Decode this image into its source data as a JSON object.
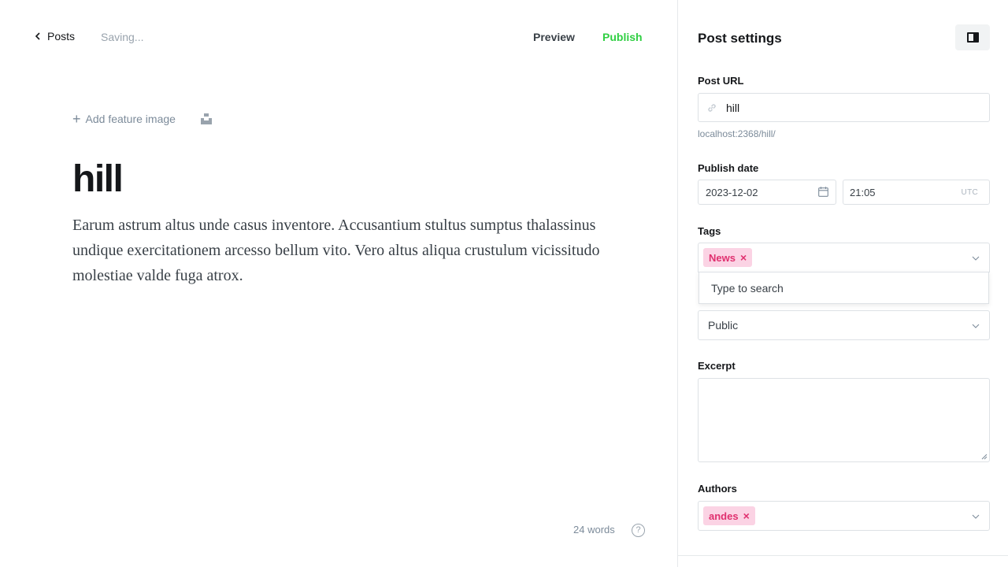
{
  "topbar": {
    "back_label": "Posts",
    "status": "Saving...",
    "preview_label": "Preview",
    "publish_label": "Publish"
  },
  "editor": {
    "add_feature_image": "Add feature image",
    "title": "hill",
    "body": "Earum astrum altus unde casus inventore. Accusantium stultus sumptus thalassinus undique exercitationem arcesso bellum vito. Vero altus aliqua crustulum vicissitudo molestiae valde fuga atrox.",
    "word_count": "24 words",
    "help_glyph": "?"
  },
  "settings": {
    "title": "Post settings",
    "post_url": {
      "label": "Post URL",
      "value": "hill",
      "hint": "localhost:2368/hill/"
    },
    "publish_date": {
      "label": "Publish date",
      "date": "2023-12-02",
      "time": "21:05",
      "timezone": "UTC"
    },
    "tags": {
      "label": "Tags",
      "tokens": [
        {
          "label": "News",
          "remove": "×"
        }
      ],
      "dropdown_hint": "Type to search"
    },
    "visibility": {
      "value": "Public"
    },
    "excerpt": {
      "label": "Excerpt",
      "value": ""
    },
    "authors": {
      "label": "Authors",
      "tokens": [
        {
          "label": "andes",
          "remove": "×"
        }
      ]
    }
  },
  "colors": {
    "publish": "#30cf43",
    "token_bg": "#fbd3e4",
    "token_text": "#e0306f"
  },
  "icons": {
    "back": "chevron-left-icon",
    "unsplash": "unsplash-icon",
    "link": "link-icon",
    "calendar": "calendar-icon",
    "dropdown": "chevron-down-icon",
    "panel_toggle": "sidebar-toggle-icon",
    "help": "help-icon"
  }
}
